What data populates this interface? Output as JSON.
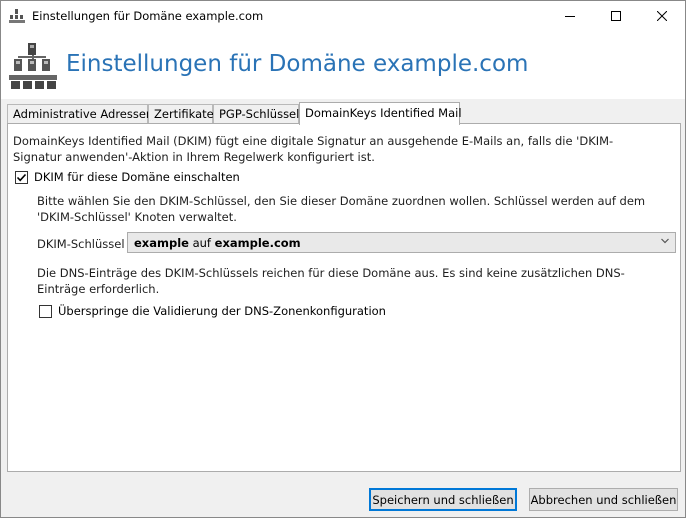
{
  "window": {
    "title": "Einstellungen für Domäne example.com",
    "controls": [
      "minimize-icon",
      "maximize-icon",
      "close-icon"
    ]
  },
  "header": {
    "heading": "Einstellungen für Domäne example.com",
    "accent_color": "#2a73b6"
  },
  "tabs": [
    {
      "label": "Administrative Adressen",
      "active": false
    },
    {
      "label": "Zertifikate",
      "active": false
    },
    {
      "label": "PGP-Schlüssel",
      "active": false
    },
    {
      "label": "DomainKeys Identified Mail",
      "active": true
    }
  ],
  "dkim": {
    "intro": "DomainKeys Identified Mail (DKIM) fügt eine digitale Signatur an ausgehende E-Mails an, falls die 'DKIM-Signatur anwenden'-Aktion in Ihrem Regelwerk konfiguriert ist.",
    "enable_label": "DKIM für diese Domäne einschalten",
    "enable_checked": true,
    "select_hint": "Bitte wählen Sie den DKIM-Schlüssel, den Sie dieser Domäne zuordnen wollen. Schlüssel werden auf dem 'DKIM-Schlüssel' Knoten verwaltet.",
    "key_label": "DKIM-Schlüssel",
    "key_value": {
      "key": "example",
      "connector": " auf ",
      "domain": "example.com"
    },
    "dns_info": "Die DNS-Einträge des DKIM-Schlüssels reichen für diese Domäne aus. Es sind keine zusätzlichen DNS-Einträge erforderlich.",
    "skip_label": "Überspringe die Validierung der DNS-Zonenkonfiguration",
    "skip_checked": false
  },
  "buttons": {
    "save": "Speichern und schließen",
    "cancel": "Abbrechen und schließen"
  }
}
